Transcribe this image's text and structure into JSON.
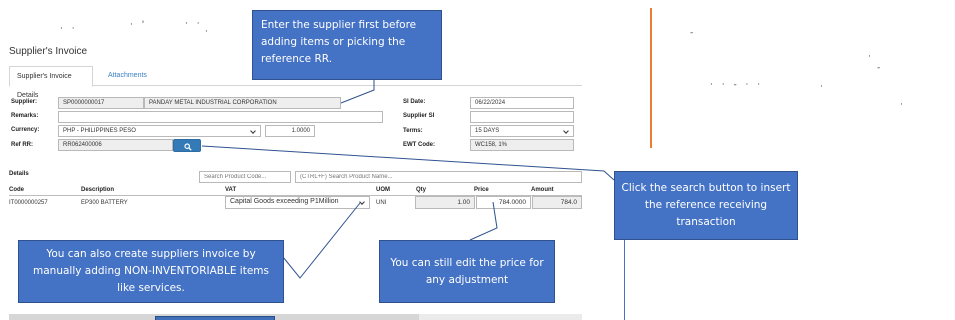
{
  "form": {
    "title": "Supplier's Invoice",
    "tabs": [
      {
        "label": "Supplier's Invoice Details"
      },
      {
        "label": "Attachments"
      }
    ],
    "fields": {
      "supplier": {
        "label": "Supplier:",
        "code": "SP0000000017",
        "name": "PANDAY METAL INDUSTRIAL CORPORATION"
      },
      "remarks": {
        "label": "Remarks:",
        "value": ""
      },
      "currency": {
        "label": "Currency:",
        "value": "PHP - PHILIPPINES PESO",
        "rate": "1.0000"
      },
      "ref_rr": {
        "label": "Ref RR:",
        "value": "RR062400006"
      },
      "si_date": {
        "label": "SI Date:",
        "value": "06/22/2024"
      },
      "supplier_si": {
        "label": "Supplier SI",
        "value": ""
      },
      "terms": {
        "label": "Terms:",
        "value": "15 DAYS"
      },
      "ewt_code": {
        "label": "EWT Code:",
        "value": "WC158, 1%"
      }
    },
    "details": {
      "label": "Details",
      "search_placeholder": "Search Product Code...",
      "search_name_placeholder": "(CTRL+F) Search Product Name...",
      "columns": [
        "Code",
        "Description",
        "VAT",
        "UOM",
        "Qty",
        "Price",
        "Amount"
      ],
      "rows": [
        {
          "code": "IT0000000257",
          "description": "EP300 BATTERY",
          "vat": "Capital Goods exceeding P1Million",
          "uom": "UNI",
          "qty": "1.00",
          "price": "784.0000",
          "amount": "784.0"
        }
      ]
    }
  },
  "callouts": {
    "supplier_first": "Enter the supplier first before adding items or picking the reference RR.",
    "search_button": "Click the search button to insert the reference receiving transaction",
    "non_inventoriable": "You can also create suppliers invoice by manually adding NON-INVENTORIABLE items like services.",
    "edit_price": "You can still edit the price for any adjustment"
  },
  "icons": {
    "search": "search-icon",
    "dropdown": "chevron-down-icon"
  },
  "colors": {
    "callout_fill": "#4472c4",
    "button": "#337ab7",
    "orange_line": "#ed7d31"
  }
}
